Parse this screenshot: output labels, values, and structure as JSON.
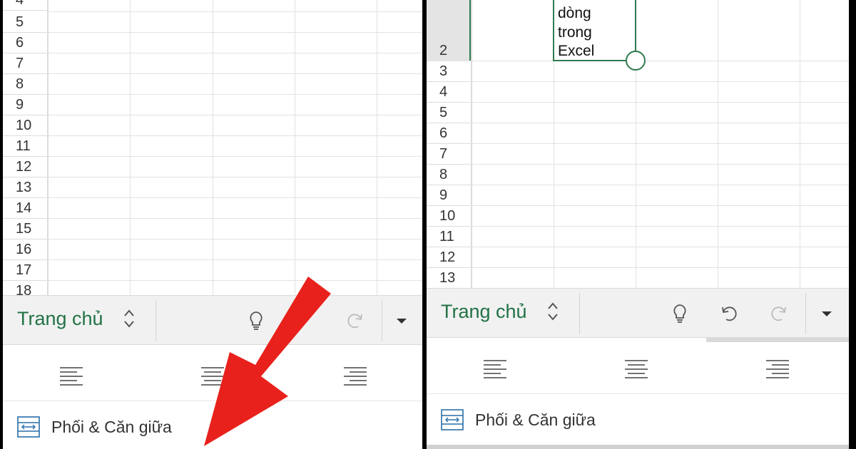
{
  "left": {
    "rows": [
      "4",
      "5",
      "6",
      "7",
      "8",
      "9",
      "10",
      "11",
      "12",
      "13",
      "14",
      "15",
      "16",
      "17",
      "18"
    ],
    "toolbar": {
      "tab_label": "Trang chủ"
    },
    "merge_label": "Phối & Căn giữa",
    "arrow_color": "#e8211c"
  },
  "right": {
    "selected_row": "2",
    "cell_text": [
      "dòng",
      "trong",
      "Excel"
    ],
    "rows": [
      "3",
      "4",
      "5",
      "6",
      "7",
      "8",
      "9",
      "10",
      "11",
      "12",
      "13"
    ],
    "toolbar": {
      "tab_label": "Trang chủ"
    },
    "merge_label": "Phối & Căn giữa"
  },
  "colors": {
    "accent": "#217346",
    "selection": "#2f7a4e",
    "toolbar_bg": "#f1f1f1"
  },
  "icons": [
    "chevron-updown-icon",
    "lightbulb-icon",
    "undo-icon",
    "redo-icon",
    "dropdown-caret-icon",
    "align-left-icon",
    "align-center-icon",
    "align-right-icon",
    "merge-center-icon"
  ]
}
